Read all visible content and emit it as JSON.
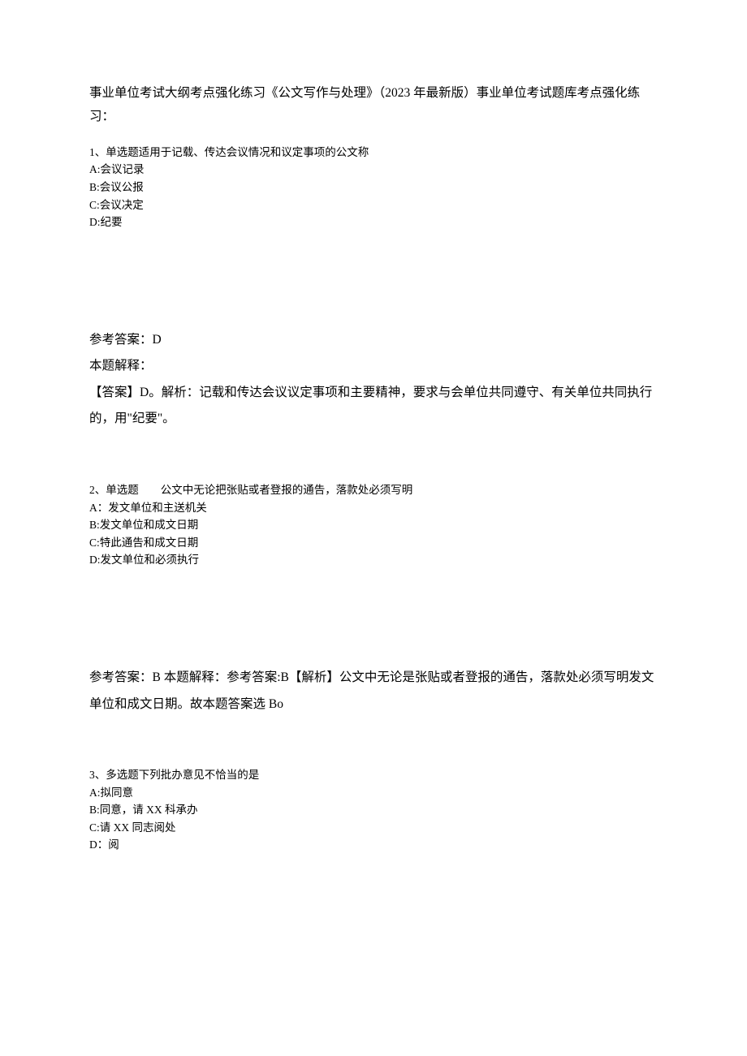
{
  "intro": "事业单位考试大纲考点强化练习《公文写作与处理》（2023 年最新版）事业单位考试题库考点强化练习：",
  "q1": {
    "stem": "1、单选题适用于记载、传达会议情况和议定事项的公文称",
    "A": "A:会议记录",
    "B": "B:会议公报",
    "C": "C:会议决定",
    "D": "D:纪要",
    "answer_label": "参考答案：D",
    "explain_title": "本题解释：",
    "explain_body": "【答案】D。解析：记载和传达会议议定事项和主要精神，要求与会单位共同遵守、有关单位共同执行的，用\"纪要\"。"
  },
  "q2": {
    "stem": "2、单选题　　公文中无论把张贴或者登报的通告，落款处必须写明",
    "A": "A：发文单位和主送机关",
    "B": "B:发文单位和成文日期",
    "C": "C:特此通告和成文日期",
    "D": "D:发文单位和必须执行",
    "answer_combined": "参考答案：B 本题解释：参考答案:B【解析】公文中无论是张贴或者登报的通告，落款处必须写明发文单位和成文日期。故本题答案选 Bo"
  },
  "q3": {
    "stem": "3、多选题下列批办意见不恰当的是",
    "A": "A:拟同意",
    "B": "B:同意，请 XX 科承办",
    "C": "C:请 XX 同志阅处",
    "D": "D：阅"
  }
}
